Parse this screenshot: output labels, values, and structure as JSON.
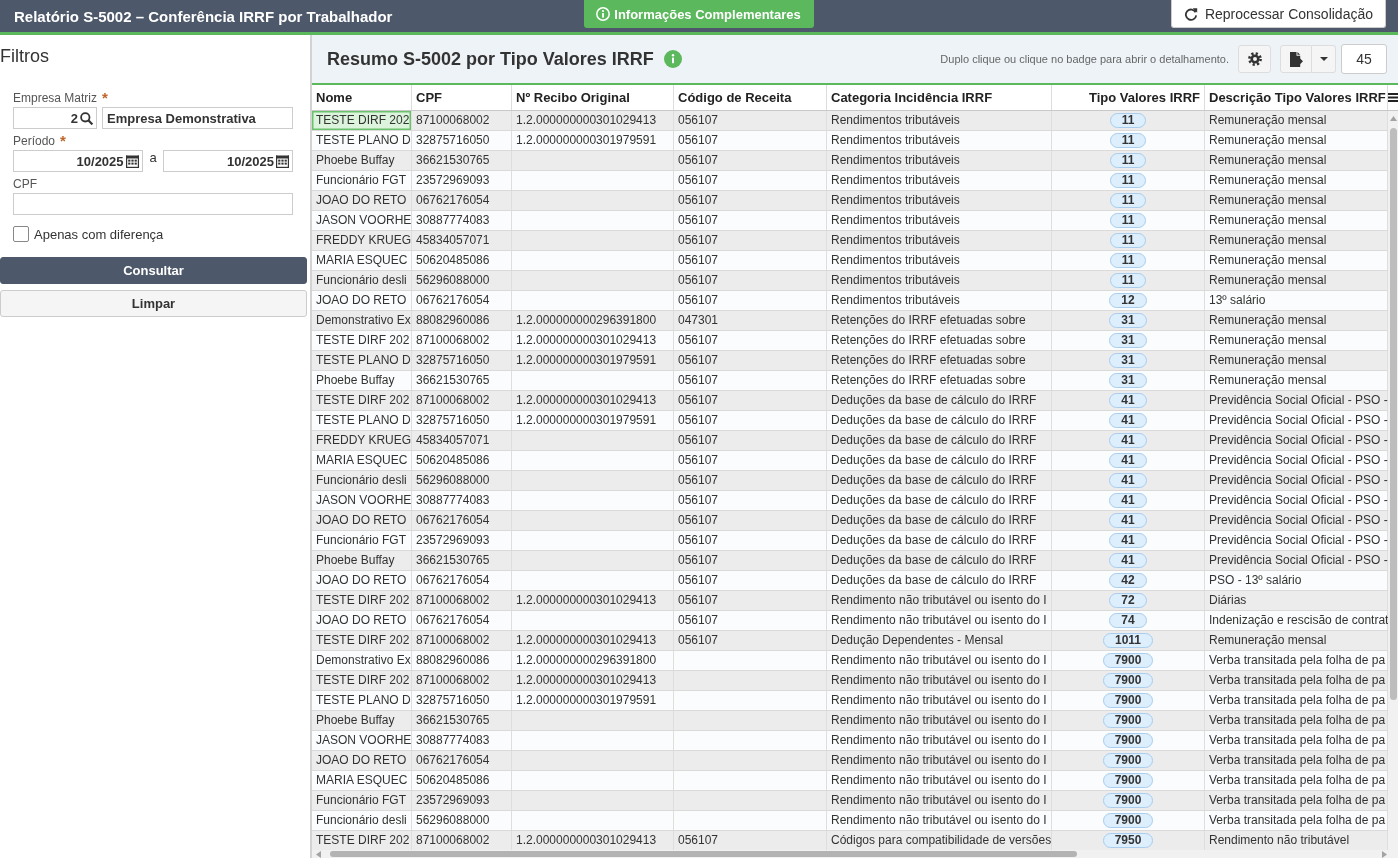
{
  "top_bar": {
    "title": "Relatório S-5002 – Conferência IRRF por Trabalhador",
    "info_button": "Informações Complementares",
    "reprocess_button": "Reprocessar Consolidação"
  },
  "filters": {
    "title": "Filtros",
    "fields": [
      {
        "kind": "lookup",
        "label": "Empresa Matriz",
        "required_mark": "*",
        "code": "2",
        "value": "Empresa Demonstrativa"
      },
      {
        "kind": "period",
        "label": "Período",
        "required_mark": "*",
        "from": "10/2025",
        "separator": "a",
        "to": "10/2025"
      },
      {
        "kind": "text",
        "label": "CPF"
      }
    ],
    "checkbox": {
      "label": "Apenas com diferença",
      "checked": false
    },
    "buttons": [
      {
        "label": "Consultar",
        "kind": "primary"
      },
      {
        "label": "Limpar",
        "kind": "secondary"
      }
    ]
  },
  "panel": {
    "title": "Resumo S-5002 por Tipo Valores IRRF",
    "hint": "Duplo clique ou clique no badge para abrir o detalhamento.",
    "page_size": "45"
  },
  "table": {
    "columns": [
      "Nome",
      "CPF",
      "Nº Recibo Original",
      "Código de Receita",
      "Categoria Incidência IRRF",
      "Tipo Valores IRRF",
      "Descrição Tipo Valores IRRF"
    ],
    "rows": [
      {
        "nome": "TESTE DIRF 202",
        "cpf": "87100068002",
        "recibo": "1.2.000000000301029413",
        "codigo": "056107",
        "categoria": "Rendimentos tributáveis",
        "tipo": "11",
        "descricao": "Remuneração mensal",
        "selected": true
      },
      {
        "nome": "TESTE PLANO D",
        "cpf": "32875716050",
        "recibo": "1.2.000000000301979591",
        "codigo": "056107",
        "categoria": "Rendimentos tributáveis",
        "tipo": "11",
        "descricao": "Remuneração mensal",
        "selected": false
      },
      {
        "nome": "Phoebe Buffay",
        "cpf": "36621530765",
        "codigo": "056107",
        "categoria": "Rendimentos tributáveis",
        "tipo": "11",
        "descricao": "Remuneração mensal",
        "selected": false
      },
      {
        "nome": "Funcionário FGT",
        "cpf": "23572969093",
        "codigo": "056107",
        "categoria": "Rendimentos tributáveis",
        "tipo": "11",
        "descricao": "Remuneração mensal",
        "selected": false
      },
      {
        "nome": "JOAO DO RETO",
        "cpf": "06762176054",
        "codigo": "056107",
        "categoria": "Rendimentos tributáveis",
        "tipo": "11",
        "descricao": "Remuneração mensal",
        "selected": false
      },
      {
        "nome": "JASON VOORHE",
        "cpf": "30887774083",
        "codigo": "056107",
        "categoria": "Rendimentos tributáveis",
        "tipo": "11",
        "descricao": "Remuneração mensal",
        "selected": false
      },
      {
        "nome": "FREDDY KRUEG",
        "cpf": "45834057071",
        "codigo": "056107",
        "categoria": "Rendimentos tributáveis",
        "tipo": "11",
        "descricao": "Remuneração mensal",
        "selected": false
      },
      {
        "nome": "MARIA ESQUEC",
        "cpf": "50620485086",
        "codigo": "056107",
        "categoria": "Rendimentos tributáveis",
        "tipo": "11",
        "descricao": "Remuneração mensal",
        "selected": false
      },
      {
        "nome": "Funcionário desli",
        "cpf": "56296088000",
        "codigo": "056107",
        "categoria": "Rendimentos tributáveis",
        "tipo": "11",
        "descricao": "Remuneração mensal",
        "selected": false
      },
      {
        "nome": "JOAO DO RETO",
        "cpf": "06762176054",
        "codigo": "056107",
        "categoria": "Rendimentos tributáveis",
        "tipo": "12",
        "descricao": "13º salário",
        "selected": false
      },
      {
        "nome": "Demonstrativo Ex",
        "cpf": "88082960086",
        "recibo": "1.2.000000000296391800",
        "codigo": "047301",
        "categoria": "Retenções do IRRF efetuadas sobre",
        "tipo": "31",
        "descricao": "Remuneração mensal",
        "selected": false
      },
      {
        "nome": "TESTE DIRF 202",
        "cpf": "87100068002",
        "recibo": "1.2.000000000301029413",
        "codigo": "056107",
        "categoria": "Retenções do IRRF efetuadas sobre",
        "tipo": "31",
        "descricao": "Remuneração mensal",
        "selected": false
      },
      {
        "nome": "TESTE PLANO D",
        "cpf": "32875716050",
        "recibo": "1.2.000000000301979591",
        "codigo": "056107",
        "categoria": "Retenções do IRRF efetuadas sobre",
        "tipo": "31",
        "descricao": "Remuneração mensal",
        "selected": false
      },
      {
        "nome": "Phoebe Buffay",
        "cpf": "36621530765",
        "codigo": "056107",
        "categoria": "Retenções do IRRF efetuadas sobre",
        "tipo": "31",
        "descricao": "Remuneração mensal",
        "selected": false
      },
      {
        "nome": "TESTE DIRF 202",
        "cpf": "87100068002",
        "recibo": "1.2.000000000301029413",
        "codigo": "056107",
        "categoria": "Deduções da base de cálculo do IRRF",
        "tipo": "41",
        "descricao": "Previdência Social Oficial - PSO -",
        "selected": false
      },
      {
        "nome": "TESTE PLANO D",
        "cpf": "32875716050",
        "recibo": "1.2.000000000301979591",
        "codigo": "056107",
        "categoria": "Deduções da base de cálculo do IRRF",
        "tipo": "41",
        "descricao": "Previdência Social Oficial - PSO -",
        "selected": false
      },
      {
        "nome": "FREDDY KRUEG",
        "cpf": "45834057071",
        "codigo": "056107",
        "categoria": "Deduções da base de cálculo do IRRF",
        "tipo": "41",
        "descricao": "Previdência Social Oficial - PSO -",
        "selected": false
      },
      {
        "nome": "MARIA ESQUEC",
        "cpf": "50620485086",
        "codigo": "056107",
        "categoria": "Deduções da base de cálculo do IRRF",
        "tipo": "41",
        "descricao": "Previdência Social Oficial - PSO -",
        "selected": false
      },
      {
        "nome": "Funcionário desli",
        "cpf": "56296088000",
        "codigo": "056107",
        "categoria": "Deduções da base de cálculo do IRRF",
        "tipo": "41",
        "descricao": "Previdência Social Oficial - PSO -",
        "selected": false
      },
      {
        "nome": "JASON VOORHE",
        "cpf": "30887774083",
        "codigo": "056107",
        "categoria": "Deduções da base de cálculo do IRRF",
        "tipo": "41",
        "descricao": "Previdência Social Oficial - PSO -",
        "selected": false
      },
      {
        "nome": "JOAO DO RETO",
        "cpf": "06762176054",
        "codigo": "056107",
        "categoria": "Deduções da base de cálculo do IRRF",
        "tipo": "41",
        "descricao": "Previdência Social Oficial - PSO -",
        "selected": false
      },
      {
        "nome": "Funcionário FGT",
        "cpf": "23572969093",
        "codigo": "056107",
        "categoria": "Deduções da base de cálculo do IRRF",
        "tipo": "41",
        "descricao": "Previdência Social Oficial - PSO -",
        "selected": false
      },
      {
        "nome": "Phoebe Buffay",
        "cpf": "36621530765",
        "codigo": "056107",
        "categoria": "Deduções da base de cálculo do IRRF",
        "tipo": "41",
        "descricao": "Previdência Social Oficial - PSO -",
        "selected": false
      },
      {
        "nome": "JOAO DO RETO",
        "cpf": "06762176054",
        "codigo": "056107",
        "categoria": "Deduções da base de cálculo do IRRF",
        "tipo": "42",
        "descricao": "PSO - 13º salário",
        "selected": false
      },
      {
        "nome": "TESTE DIRF 202",
        "cpf": "87100068002",
        "recibo": "1.2.000000000301029413",
        "codigo": "056107",
        "categoria": "Rendimento não tributável ou isento do I",
        "tipo": "72",
        "descricao": "Diárias",
        "selected": false
      },
      {
        "nome": "JOAO DO RETO",
        "cpf": "06762176054",
        "codigo": "056107",
        "categoria": "Rendimento não tributável ou isento do I",
        "tipo": "74",
        "descricao": "Indenização e rescisão de contrat",
        "selected": false
      },
      {
        "nome": "TESTE DIRF 202",
        "cpf": "87100068002",
        "recibo": "1.2.000000000301029413",
        "codigo": "056107",
        "categoria": "Dedução Dependentes - Mensal",
        "tipo": "1011",
        "descricao": "Remuneração mensal",
        "selected": false
      },
      {
        "nome": "Demonstrativo Ex",
        "cpf": "88082960086",
        "recibo": "1.2.000000000296391800",
        "categoria": "Rendimento não tributável ou isento do I",
        "tipo": "7900",
        "descricao": "Verba transitada pela folha de pa",
        "selected": false
      },
      {
        "nome": "TESTE DIRF 202",
        "cpf": "87100068002",
        "recibo": "1.2.000000000301029413",
        "categoria": "Rendimento não tributável ou isento do I",
        "tipo": "7900",
        "descricao": "Verba transitada pela folha de pa",
        "selected": false
      },
      {
        "nome": "TESTE PLANO D",
        "cpf": "32875716050",
        "recibo": "1.2.000000000301979591",
        "categoria": "Rendimento não tributável ou isento do I",
        "tipo": "7900",
        "descricao": "Verba transitada pela folha de pa",
        "selected": false
      },
      {
        "nome": "Phoebe Buffay",
        "cpf": "36621530765",
        "categoria": "Rendimento não tributável ou isento do I",
        "tipo": "7900",
        "descricao": "Verba transitada pela folha de pa",
        "selected": false
      },
      {
        "nome": "JASON VOORHE",
        "cpf": "30887774083",
        "categoria": "Rendimento não tributável ou isento do I",
        "tipo": "7900",
        "descricao": "Verba transitada pela folha de pa",
        "selected": false
      },
      {
        "nome": "JOAO DO RETO",
        "cpf": "06762176054",
        "categoria": "Rendimento não tributável ou isento do I",
        "tipo": "7900",
        "descricao": "Verba transitada pela folha de pa",
        "selected": false
      },
      {
        "nome": "MARIA ESQUEC",
        "cpf": "50620485086",
        "categoria": "Rendimento não tributável ou isento do I",
        "tipo": "7900",
        "descricao": "Verba transitada pela folha de pa",
        "selected": false
      },
      {
        "nome": "Funcionário FGT",
        "cpf": "23572969093",
        "categoria": "Rendimento não tributável ou isento do I",
        "tipo": "7900",
        "descricao": "Verba transitada pela folha de pa",
        "selected": false
      },
      {
        "nome": "Funcionário desli",
        "cpf": "56296088000",
        "categoria": "Rendimento não tributável ou isento do I",
        "tipo": "7900",
        "descricao": "Verba transitada pela folha de pa",
        "selected": false
      },
      {
        "nome": "TESTE DIRF 202",
        "cpf": "87100068002",
        "recibo": "1.2.000000000301029413",
        "codigo": "056107",
        "categoria": "Códigos para compatibilidade de versões",
        "tipo": "7950",
        "descricao": "Rendimento não tributável",
        "selected": false
      }
    ]
  }
}
